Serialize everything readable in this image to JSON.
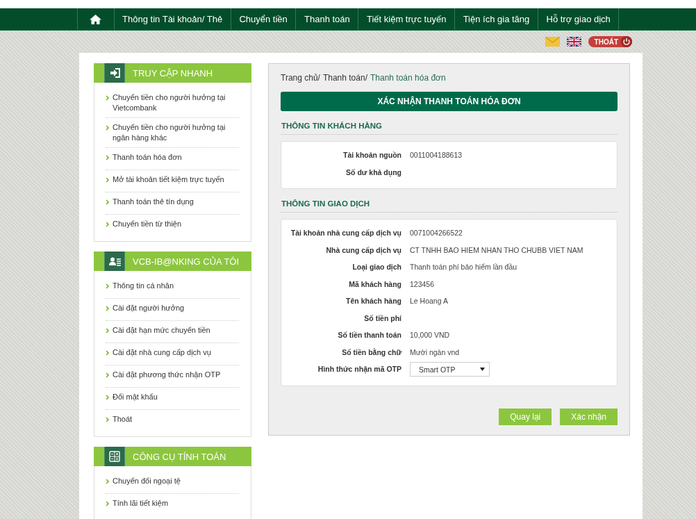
{
  "nav": {
    "items": [
      {
        "label": "Thông tin Tài khoản/ Thẻ"
      },
      {
        "label": "Chuyển tiền"
      },
      {
        "label": "Thanh toán"
      },
      {
        "label": "Tiết kiệm trực tuyến"
      },
      {
        "label": "Tiện ích gia tăng"
      },
      {
        "label": "Hỗ trợ giao dịch"
      }
    ]
  },
  "logout": {
    "label": "THOÁT"
  },
  "sidebar": [
    {
      "title": "TRUY CẬP NHANH",
      "kind": "enter",
      "items": [
        "Chuyển tiền cho người hưởng tại Vietcombank",
        "Chuyển tiền cho người hưởng tại ngân hàng khác",
        "Thanh toán hóa đơn",
        "Mở tài khoản tiết kiệm trực tuyến",
        "Thanh toán thẻ tín dụng",
        "Chuyển tiền từ thiện"
      ]
    },
    {
      "title": "VCB-IB@NKING CỦA TÔI",
      "kind": "user",
      "items": [
        "Thông tin cá nhân",
        "Cài đặt người hưởng",
        "Cài đặt hạn mức chuyển tiền",
        "Cài đặt nhà cung cấp dịch vụ",
        "Cài đặt phương thức nhận OTP",
        "Đổi mật khẩu",
        "Thoát"
      ]
    },
    {
      "title": "CÔNG CỤ TÍNH TOÁN",
      "kind": "calculator",
      "items": [
        "Chuyển đổi ngoại tệ",
        "Tính lãi tiết kiệm"
      ]
    }
  ],
  "breadcrumb": [
    {
      "label": "Trang chủ/",
      "current": false
    },
    {
      "label": "Thanh toán/",
      "current": false
    },
    {
      "label": "Thanh toán hóa đơn",
      "current": true
    }
  ],
  "banner": "XÁC NHẬN THANH TOÁN HÓA ĐƠN",
  "sections": [
    {
      "title": "THÔNG TIN KHÁCH HÀNG",
      "rows": [
        {
          "kind": "text",
          "label": "Tài khoản nguồn",
          "value": "0011004188613"
        },
        {
          "kind": "text",
          "label": "Số dư khả dụng"
        }
      ]
    },
    {
      "title": "THÔNG TIN GIAO DỊCH",
      "rows": [
        {
          "kind": "text",
          "label": "Tài khoản nhà cung cấp dịch vụ",
          "value": "0071004266522"
        },
        {
          "kind": "text",
          "label": "Nhà cung cấp dịch vụ",
          "value": "CT TNHH BAO HIEM NHAN THO CHUBB VIET NAM"
        },
        {
          "kind": "text",
          "label": "Loại giao dịch",
          "value": "Thanh toán phí bảo hiểm lần đầu"
        },
        {
          "kind": "text",
          "label": "Mã khách hàng",
          "value": "123456"
        },
        {
          "kind": "text",
          "label": "Tên khách hàng",
          "value": "Le Hoang A"
        },
        {
          "kind": "text",
          "label": "Số tiền phí"
        },
        {
          "kind": "text",
          "label": "Số tiền thanh toán",
          "value": "10,000 VND"
        },
        {
          "kind": "text",
          "label": "Số tiền bằng chữ",
          "value": "Mười ngàn vnd"
        },
        {
          "kind": "select",
          "label": "Hình thức nhận mã OTP",
          "value": "Smart OTP"
        }
      ]
    }
  ],
  "buttons": [
    "Quay lại",
    "Xác nhận"
  ]
}
